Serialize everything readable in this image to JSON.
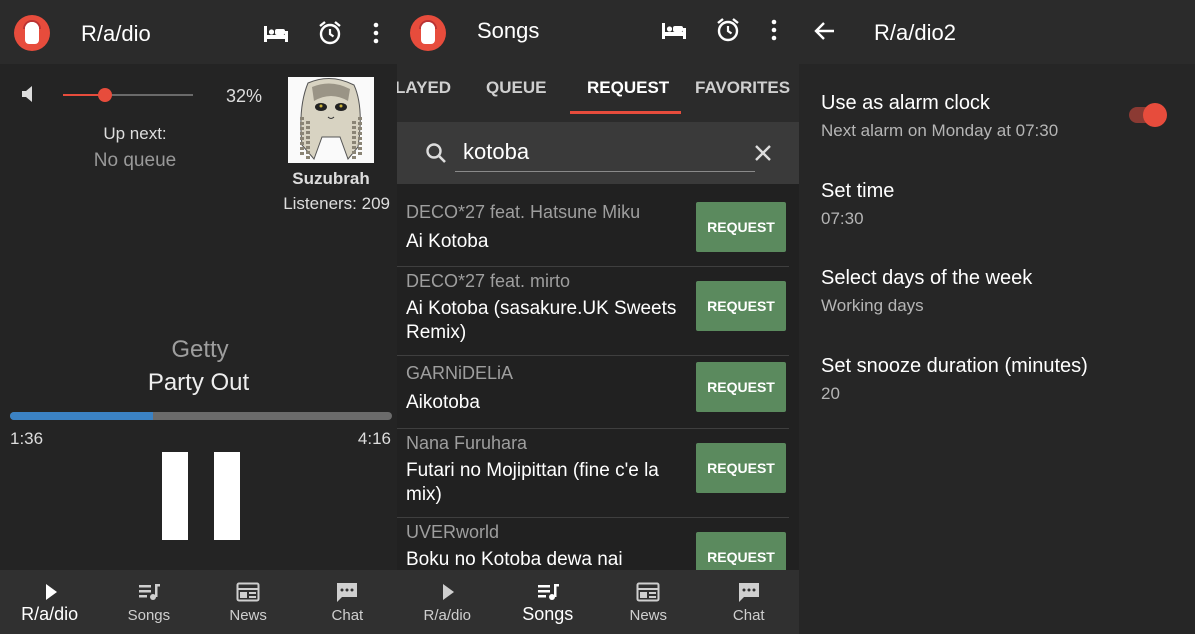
{
  "colors": {
    "accent": "#e74c3c",
    "progress": "#3b82c4",
    "request_button": "#5b8a5e"
  },
  "player": {
    "app_title": "R/a/dio",
    "volume_percent_label": "32%",
    "volume_level": 0.32,
    "up_next_label": "Up next:",
    "up_next_value": "No queue",
    "dj_name": "Suzubrah",
    "listeners": "Listeners: 209",
    "artist": "Getty",
    "song": "Party Out",
    "progress": 0.375,
    "time_current": "1:36",
    "time_total": "4:16",
    "icons": [
      "sleep-timer-icon",
      "alarm-icon",
      "more-vert-icon",
      "volume-icon",
      "pause-icon"
    ]
  },
  "songs": {
    "title": "Songs",
    "tabs": [
      {
        "label": "LAYED"
      },
      {
        "label": "QUEUE"
      },
      {
        "label": "REQUEST",
        "active": true
      },
      {
        "label": "FAVORITES"
      }
    ],
    "search_value": "kotoba",
    "results": [
      {
        "artist": "DECO*27 feat. Hatsune Miku",
        "title": "Ai Kotoba",
        "button": "REQUEST"
      },
      {
        "artist": "DECO*27 feat. mirto",
        "title": "Ai Kotoba (sasakure.UK Sweets Remix)",
        "button": "REQUEST"
      },
      {
        "artist": "GARNiDELiA",
        "title": "Aikotoba",
        "button": "REQUEST"
      },
      {
        "artist": "Nana Furuhara",
        "title": "Futari no Mojipittan (fine c'e la mix)",
        "button": "REQUEST"
      },
      {
        "artist": "UVERworld",
        "title": "Boku no Kotoba dewa nai",
        "button": "REQUEST"
      }
    ]
  },
  "nav": {
    "items": [
      {
        "label": "R/a/dio",
        "icon": "play-icon"
      },
      {
        "label": "Songs",
        "icon": "queue-music-icon"
      },
      {
        "label": "News",
        "icon": "news-icon"
      },
      {
        "label": "Chat",
        "icon": "chat-icon"
      }
    ]
  },
  "alarm": {
    "title": "R/a/dio2",
    "settings": [
      {
        "title": "Use as alarm clock",
        "subtitle": "Next alarm on Monday at 07:30",
        "toggle": true
      },
      {
        "title": "Set time",
        "subtitle": "07:30"
      },
      {
        "title": "Select days of the week",
        "subtitle": "Working days"
      },
      {
        "title": "Set snooze duration (minutes)",
        "subtitle": "20"
      }
    ]
  }
}
